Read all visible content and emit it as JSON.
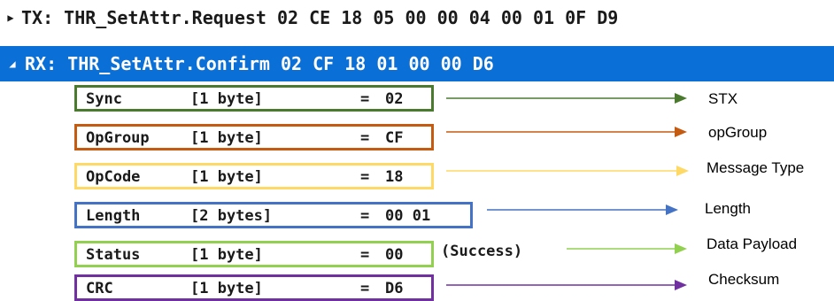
{
  "tree": {
    "tx": {
      "expander": "▶",
      "text": "TX: THR_SetAttr.Request 02 CE 18 05 00 00 04 00 01 0F D9"
    },
    "rx": {
      "expander": "◢",
      "text": "RX: THR_SetAttr.Confirm 02 CF 18 01 00 00 D6"
    }
  },
  "fields": [
    {
      "name": "Sync",
      "size": "[1 byte]",
      "eq": "=",
      "value": "02",
      "extra": "",
      "label": "STX",
      "color": "#4a7a2e"
    },
    {
      "name": "OpGroup",
      "size": "[1 byte]",
      "eq": "=",
      "value": "CF",
      "extra": "",
      "label": "opGroup",
      "color": "#c55a11"
    },
    {
      "name": "OpCode",
      "size": "[1 byte]",
      "eq": "=",
      "value": "18",
      "extra": "",
      "label": "Message Type",
      "color": "#ffd966"
    },
    {
      "name": "Length",
      "size": "[2 bytes]",
      "eq": "=",
      "value": "00 01",
      "extra": "",
      "label": "Length",
      "color": "#4472c4"
    },
    {
      "name": "Status",
      "size": "[1 byte]",
      "eq": "=",
      "value": "00",
      "extra": "(Success)",
      "label": "Data Payload",
      "color": "#92d050"
    },
    {
      "name": "CRC",
      "size": "[1 byte]",
      "eq": "=",
      "value": "D6",
      "extra": "",
      "label": "Checksum",
      "color": "#7030a0"
    }
  ],
  "colors": {
    "selection": "#0a6fd6"
  }
}
